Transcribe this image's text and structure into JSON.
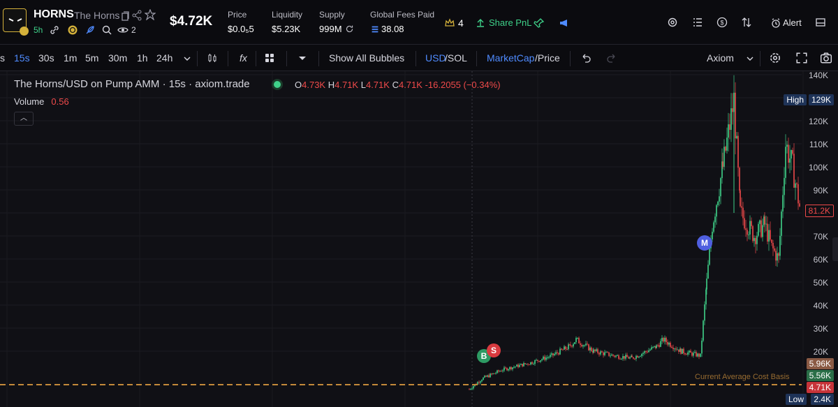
{
  "token": {
    "ticker": "HORNS",
    "name": "The Horns",
    "age": "5h",
    "watchers": "2",
    "price_big": "$4.72K"
  },
  "stats": [
    {
      "label": "Price",
      "value": "$0.0₅5"
    },
    {
      "label": "Liquidity",
      "value": "$5.23K"
    },
    {
      "label": "Supply",
      "value": "999M"
    },
    {
      "label": "Global Fees Paid",
      "value": "38.08"
    }
  ],
  "top_actions": {
    "crown_count": "4",
    "share_pnl": "Share PnL",
    "alert": "Alert"
  },
  "toolbar": {
    "timeframes": [
      "s",
      "15s",
      "30s",
      "1m",
      "5m",
      "30m",
      "1h",
      "24h"
    ],
    "active_timeframe": "15s",
    "show_all_bubbles": "Show All Bubbles",
    "currency_usd": "USD",
    "currency_sol": "/SOL",
    "mcap": "MarketCap",
    "price": "/Price",
    "platform": "Axiom",
    "indicator": "fx"
  },
  "legend": {
    "title": "The Horns/USD on Pump AMM · 15s · axiom.trade",
    "o_label": "O",
    "o": "4.73K",
    "h_label": "H",
    "h": "4.71K",
    "l_label": "L",
    "l": "4.71K",
    "c_label": "C",
    "c": "4.71K",
    "change": "-16.2055 (−0.34%)",
    "volume_label": "Volume",
    "volume": "0.56"
  },
  "axis": {
    "ticks": [
      "140K",
      "120K",
      "110K",
      "100K",
      "90K",
      "70K",
      "60K",
      "50K",
      "40K",
      "30K",
      "20K"
    ],
    "high_label": "High",
    "high_value": "129K",
    "low_label": "Low",
    "low_value": "2.4K",
    "current_tag": "81.2K",
    "tag_596": "5.96K",
    "tag_556": "5.56K",
    "tag_471": "4.71K"
  },
  "markers": {
    "buy": "B",
    "sell": "S",
    "migration": "M"
  },
  "cost_basis_label": "Current Average Cost Basis",
  "colors": {
    "up": "#3fd28a",
    "down": "#ef4a4a",
    "accent": "#4f8bff",
    "gold": "#d4b13a"
  },
  "chart_data": {
    "type": "candlestick",
    "y_axis": "MarketCap (USD)",
    "ylim": [
      0,
      145000
    ],
    "approx_close_path": [
      3500,
      8000,
      12000,
      15000,
      18000,
      22000,
      25000,
      20000,
      18000,
      17000,
      22000,
      25000,
      20000,
      18000,
      50000,
      75000,
      100000,
      129000,
      80000,
      70000,
      75000,
      65000,
      60000,
      110000,
      100000,
      81200
    ]
  }
}
